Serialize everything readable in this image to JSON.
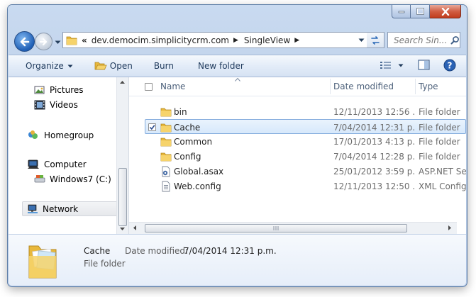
{
  "address": {
    "overflow_glyph": "«",
    "crumbs": [
      "dev.democim.simplicitycrm.com",
      "SingleView"
    ]
  },
  "search": {
    "placeholder": "Search Sin..."
  },
  "toolbar": {
    "organize": "Organize",
    "open": "Open",
    "burn": "Burn",
    "new_folder": "New folder"
  },
  "nav_pane": {
    "items": [
      "Pictures",
      "Videos",
      "Homegroup",
      "Computer",
      "Windows7 (C:)",
      "Network"
    ],
    "selected": "Network"
  },
  "columns": [
    "Name",
    "Date modified",
    "Type"
  ],
  "files": [
    {
      "name": "bin",
      "date": "12/11/2013 12:56 ...",
      "type": "File folder",
      "icon": "folder-icon"
    },
    {
      "name": "Cache",
      "date": "7/04/2014 12:31 p....",
      "type": "File folder",
      "icon": "folder-icon",
      "selected": true
    },
    {
      "name": "Common",
      "date": "17/01/2013 4:13 p...",
      "type": "File folder",
      "icon": "folder-icon"
    },
    {
      "name": "Config",
      "date": "7/04/2014 12:28 p....",
      "type": "File folder",
      "icon": "folder-icon"
    },
    {
      "name": "Global.asax",
      "date": "25/01/2012 3:59 p...",
      "type": "ASP.NET Serv",
      "icon": "asax-file-icon"
    },
    {
      "name": "Web.config",
      "date": "12/11/2013 12:50 ...",
      "type": "XML Configu",
      "icon": "config-file-icon"
    }
  ],
  "details": {
    "name": "Cache",
    "kind": "File folder",
    "date_label": "Date modified:",
    "date_value": "7/04/2014 12:31 p.m."
  },
  "colors": {
    "accent": "#1e395b",
    "selection": "#d7e8fb",
    "folder": "#f2c94c"
  }
}
